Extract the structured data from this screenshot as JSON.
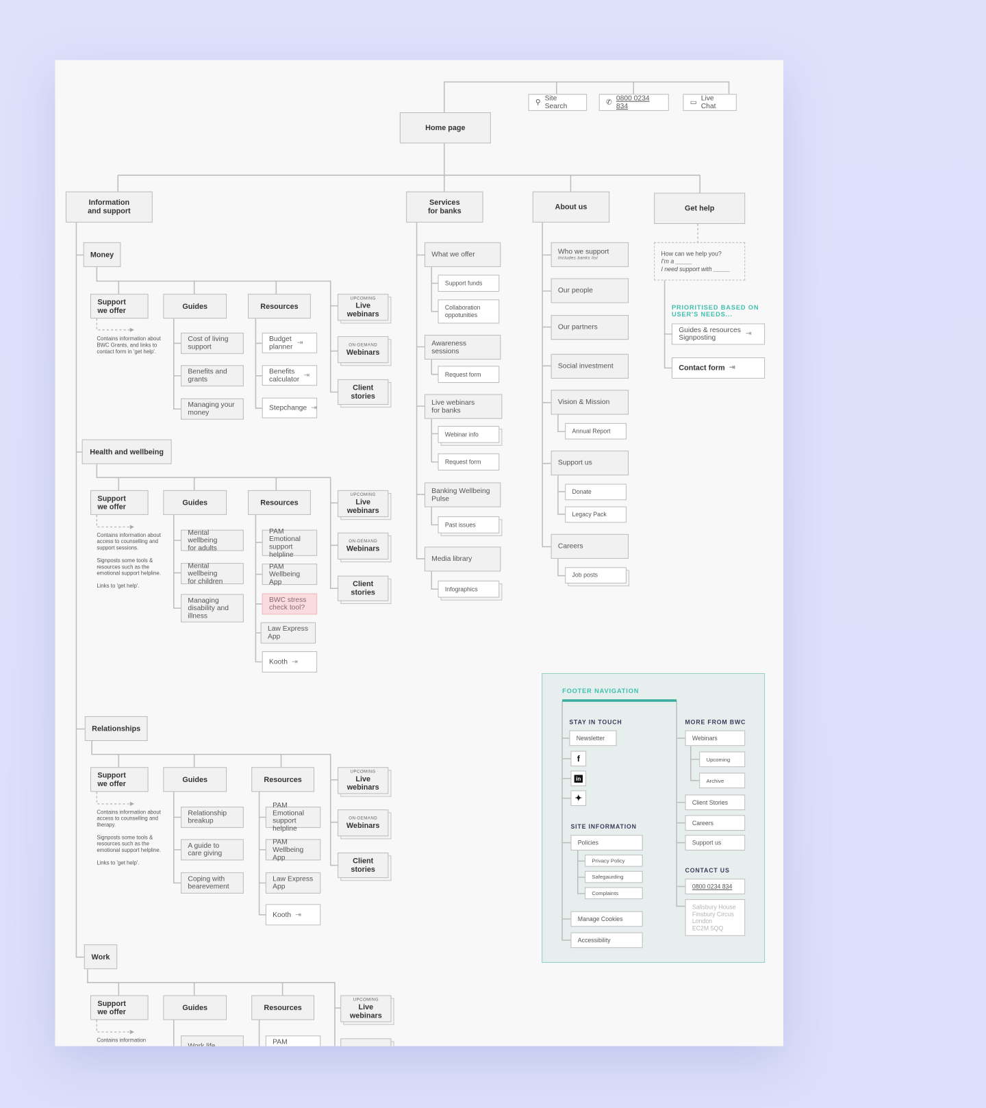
{
  "header_actions": {
    "site_search": "Site Search",
    "phone": "0800 0234 834",
    "live_chat": "Live Chat"
  },
  "home": "Home page",
  "nav": {
    "info": "Information\nand support",
    "services": "Services\nfor banks",
    "about": "About us",
    "get_help": "Get help"
  },
  "topics": [
    {
      "title": "Money",
      "support": "Support\nwe offer",
      "note": "Contains information about BWC Grants, and links to contact form in 'get help'.",
      "guides_label": "Guides",
      "guides": [
        "Cost of living\nsupport",
        "Benefits and\ngrants",
        "Managing your\nmoney"
      ],
      "resources_label": "Resources",
      "resources": [
        "Budget\nplanner",
        "Benefits\ncalculator",
        "Stepchange"
      ],
      "cards": [
        {
          "kicker": "UPCOMING",
          "label": "Live webinars"
        },
        {
          "kicker": "ON-DEMAND",
          "label": "Webinars"
        },
        {
          "kicker": "",
          "label": "Client stories"
        }
      ]
    },
    {
      "title": "Health and wellbeing",
      "support": "Support\nwe offer",
      "note": "Contains information about access to counselling and support sessions.\n\nSignposts some tools & resources such as the emotional support helpline.\n\nLinks to 'get help'.",
      "guides_label": "Guides",
      "guides": [
        "Mental wellbeing\nfor adults",
        "Mental wellbeing\nfor children",
        "Managing\ndisability and\nillness"
      ],
      "resources_label": "Resources",
      "resources": [
        "PAM Emotional\nsupport\nhelpline",
        "PAM Wellbeing\nApp",
        "BWC stress\ncheck tool?",
        "Law Express\nApp",
        "Kooth"
      ],
      "cards": [
        {
          "kicker": "UPCOMING",
          "label": "Live webinars"
        },
        {
          "kicker": "ON-DEMAND",
          "label": "Webinars"
        },
        {
          "kicker": "",
          "label": "Client stories"
        }
      ]
    },
    {
      "title": "Relationships",
      "support": "Support\nwe offer",
      "note": "Contains information about access to counselling and therapy.\n\nSignposts some tools & resources such as the emotional support helpline.\n\nLinks to 'get help'.",
      "guides_label": "Guides",
      "guides": [
        "Relationship\nbreakup",
        "A guide to\ncare giving",
        "Coping with\nbearevement"
      ],
      "resources_label": "Resources",
      "resources": [
        "PAM Emotional\nsupport helpline",
        "PAM Wellbeing\nApp",
        "Law Express\nApp",
        "Kooth"
      ],
      "cards": [
        {
          "kicker": "UPCOMING",
          "label": "Live webinars"
        },
        {
          "kicker": "ON-DEMAND",
          "label": "Webinars"
        },
        {
          "kicker": "",
          "label": "Client stories"
        }
      ]
    },
    {
      "title": "Work",
      "support": "Support\nwe offer",
      "note": "Contains information",
      "guides_label": "Guides",
      "guides": [
        "Work life"
      ],
      "resources_label": "Resources",
      "resources": [
        "PAM Emotional"
      ],
      "cards": [
        {
          "kicker": "UPCOMING",
          "label": "Live webinars"
        },
        {
          "kicker": "ON-DEMAND",
          "label": ""
        }
      ]
    }
  ],
  "services": [
    {
      "label": "What we offer",
      "children": [
        "Support funds",
        "Collaboration\noppotunities"
      ]
    },
    {
      "label": "Awareness\nsessions",
      "children": [
        "Request form"
      ]
    },
    {
      "label": "Live webinars\nfor banks",
      "children": [
        "Webinar info",
        "Request form"
      ]
    },
    {
      "label": "Banking Wellbeing\nPulse",
      "children": [
        "Past issues"
      ]
    },
    {
      "label": "Media library",
      "children": [
        "Infographics"
      ]
    }
  ],
  "about": [
    {
      "label": "Who we support",
      "sub": "Includes banks list",
      "children": []
    },
    {
      "label": "Our people",
      "children": []
    },
    {
      "label": "Our partners",
      "children": []
    },
    {
      "label": "Social investment",
      "children": []
    },
    {
      "label": "Vision & Mission",
      "children": [
        "Annual Report"
      ]
    },
    {
      "label": "Support us",
      "children": [
        "Donate",
        "Legacy Pack"
      ]
    },
    {
      "label": "Careers",
      "children": [
        "Job posts"
      ]
    }
  ],
  "get_help": {
    "question": "How can we help you?",
    "line1": "I'm a _____",
    "line2": "I need support with _____",
    "prioritised": "PRIORITISED BASED ON\nUSER'S NEEDS...",
    "guides": "Guides & resources",
    "guides_sub": "Signposting",
    "contact": "Contact form"
  },
  "footer": {
    "title": "FOOTER NAVIGATION",
    "stay_in_touch": "STAY IN TOUCH",
    "newsletter": "Newsletter",
    "social": [
      "facebook-icon",
      "linkedin-icon",
      "twitter-icon"
    ],
    "site_information": "SITE INFORMATION",
    "policies": "Policies",
    "policy_items": [
      "Privacy Policy",
      "Safegaurding",
      "Complaints"
    ],
    "manage_cookies": "Manage Cookies",
    "accessibility": "Accessibility",
    "more_from": "MORE FROM BWC",
    "webinars": "Webinars",
    "webinar_items": [
      "Upcoming",
      "Archive"
    ],
    "client_stories": "Client Stories",
    "careers": "Careers",
    "support_us": "Support us",
    "contact_us": "CONTACT US",
    "phone": "0800 0234 834",
    "address": "Salisbury House\nFinsbury Circus\nLondon\nEC2M 5QQ"
  },
  "colors": {
    "accent": "#3dbfae",
    "highlight": "#fadcdf",
    "node_fill": "#f1f1f1",
    "border": "#bcbcbc",
    "background": "#dfe1fb"
  }
}
